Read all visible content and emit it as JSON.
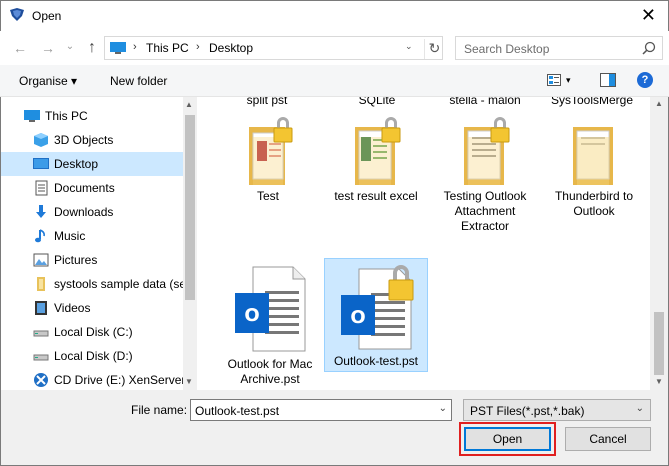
{
  "window": {
    "title": "Open",
    "close_glyph": "✕"
  },
  "nav": {
    "back_glyph": "←",
    "forward_glyph": "→",
    "recent_glyph": "⌄",
    "up_glyph": "↑",
    "breadcrumb": [
      "This PC",
      "Desktop"
    ],
    "crumb_separator": "›",
    "dropdown_glyph": "⌄",
    "refresh_glyph": "↻",
    "search_placeholder": "Search Desktop"
  },
  "toolbar": {
    "organise_label": "Organise ▾",
    "new_folder_label": "New folder",
    "view_dropdown_glyph": "▾",
    "help_glyph": "?"
  },
  "sidebar": {
    "items": [
      {
        "label": "This PC",
        "icon": "pc-icon"
      },
      {
        "label": "3D Objects",
        "icon": "cube-icon"
      },
      {
        "label": "Desktop",
        "icon": "desktop-icon"
      },
      {
        "label": "Documents",
        "icon": "documents-icon"
      },
      {
        "label": "Downloads",
        "icon": "downloads-icon"
      },
      {
        "label": "Music",
        "icon": "music-icon"
      },
      {
        "label": "Pictures",
        "icon": "pictures-icon"
      },
      {
        "label": "systools sample data (se",
        "icon": "folder-icon"
      },
      {
        "label": "Videos",
        "icon": "videos-icon"
      },
      {
        "label": "Local Disk (C:)",
        "icon": "drive-icon"
      },
      {
        "label": "Local Disk (D:)",
        "icon": "drive-icon"
      },
      {
        "label": "CD Drive (E:) XenServer T",
        "icon": "cd-drive-icon"
      }
    ],
    "selected_index": 2,
    "scroll_up_glyph": "▲",
    "scroll_down_glyph": "▼"
  },
  "files": {
    "partial_row": [
      "split pst",
      "SQLite",
      "stella - malon",
      "SysToolsMerge"
    ],
    "row1": [
      {
        "label_lines": [
          "Test"
        ],
        "icon": "locked-folder-icon"
      },
      {
        "label_lines": [
          "test result excel"
        ],
        "icon": "locked-folder-icon"
      },
      {
        "label_lines": [
          "Testing Outlook",
          "Attachment",
          "Extractor"
        ],
        "icon": "locked-folder-icon"
      },
      {
        "label_lines": [
          "Thunderbird to",
          "Outlook"
        ],
        "icon": "folder-icon"
      }
    ],
    "row2": [
      {
        "label_lines": [
          "Outlook for Mac",
          "Archive.pst"
        ],
        "icon": "outlook-pst-icon",
        "badge": "O"
      },
      {
        "label_lines": [
          "Outlook-test.pst"
        ],
        "icon": "locked-outlook-pst-icon",
        "badge": "O"
      }
    ],
    "selected": "Outlook-test.pst"
  },
  "bottom": {
    "file_name_label": "File name:",
    "file_name_value": "Outlook-test.pst",
    "file_type_value": "PST Files(*.pst,*.bak)",
    "dropdown_glyph": "⌄",
    "open_label": "Open",
    "cancel_label": "Cancel"
  },
  "colors": {
    "accent": "#0078d7",
    "selection": "#cce8ff",
    "highlight_outline": "#e02020",
    "outlook_blue": "#0a64c8",
    "folder_yellow": "#f5d47a"
  }
}
